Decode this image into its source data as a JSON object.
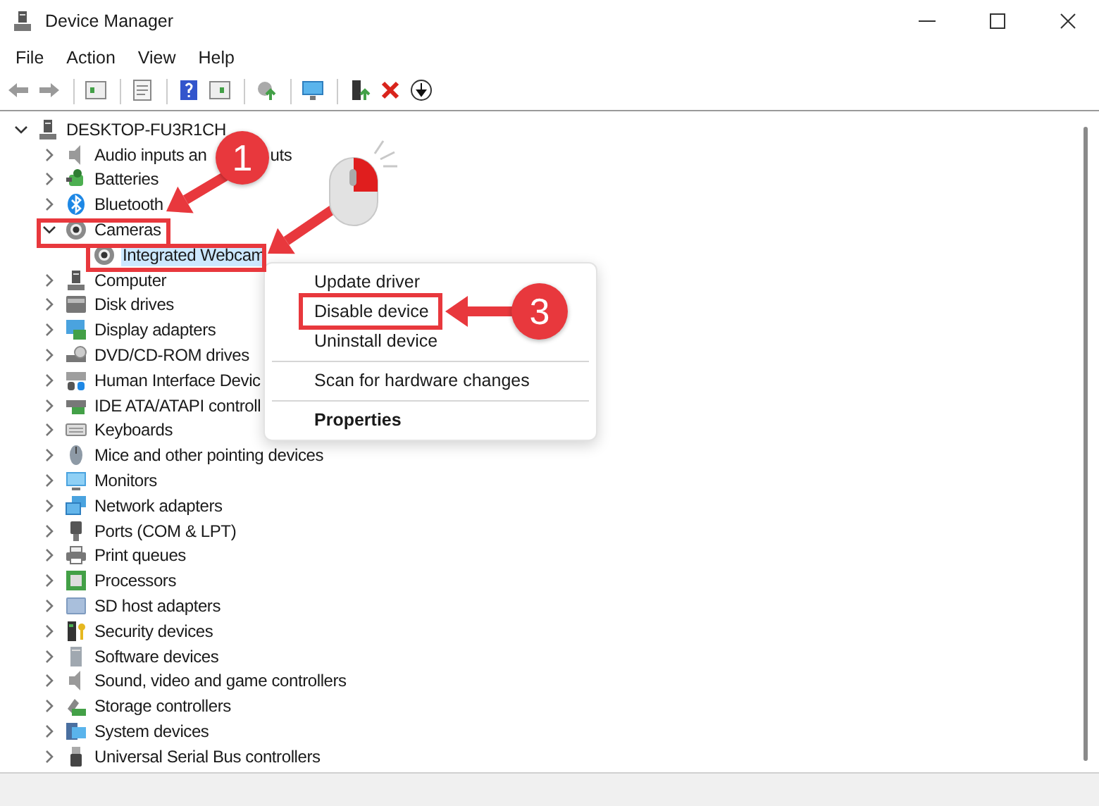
{
  "window": {
    "title": "Device Manager"
  },
  "menu_bar": [
    {
      "label": "File"
    },
    {
      "label": "Action"
    },
    {
      "label": "View"
    },
    {
      "label": "Help"
    }
  ],
  "tree": {
    "label": "DESKTOP-FU3R1CH",
    "expanded": true,
    "selected": false,
    "children": [
      {
        "label": "Audio inputs an",
        "label_tail": "uts",
        "expanded": false,
        "selected": false
      },
      {
        "label": "Batteries",
        "expanded": false,
        "selected": false
      },
      {
        "label": "Bluetooth",
        "expanded": false,
        "selected": false
      },
      {
        "label": "Cameras",
        "expanded": true,
        "selected": false,
        "children": [
          {
            "label": "Integrated Webcam",
            "selected": true
          }
        ]
      },
      {
        "label": "Computer",
        "expanded": false,
        "selected": false
      },
      {
        "label": "Disk drives",
        "expanded": false,
        "selected": false
      },
      {
        "label": "Display adapters",
        "expanded": false,
        "selected": false
      },
      {
        "label": "DVD/CD-ROM drives",
        "expanded": false,
        "selected": false
      },
      {
        "label": "Human Interface Devic",
        "expanded": false,
        "selected": false
      },
      {
        "label": "IDE ATA/ATAPI controll",
        "expanded": false,
        "selected": false
      },
      {
        "label": "Keyboards",
        "expanded": false,
        "selected": false
      },
      {
        "label": "Mice and other pointing devices",
        "expanded": false,
        "selected": false
      },
      {
        "label": "Monitors",
        "expanded": false,
        "selected": false
      },
      {
        "label": "Network adapters",
        "expanded": false,
        "selected": false
      },
      {
        "label": "Ports (COM & LPT)",
        "expanded": false,
        "selected": false
      },
      {
        "label": "Print queues",
        "expanded": false,
        "selected": false
      },
      {
        "label": "Processors",
        "expanded": false,
        "selected": false
      },
      {
        "label": "SD host adapters",
        "expanded": false,
        "selected": false
      },
      {
        "label": "Security devices",
        "expanded": false,
        "selected": false
      },
      {
        "label": "Software devices",
        "expanded": false,
        "selected": false
      },
      {
        "label": "Sound, video and game controllers",
        "expanded": false,
        "selected": false
      },
      {
        "label": "Storage controllers",
        "expanded": false,
        "selected": false
      },
      {
        "label": "System devices",
        "expanded": false,
        "selected": false
      },
      {
        "label": "Universal Serial Bus controllers",
        "expanded": false,
        "selected": false
      }
    ]
  },
  "context_menu": {
    "groups": [
      {
        "items": [
          {
            "label": "Update driver",
            "default": false
          },
          {
            "label": "Disable device",
            "default": false
          },
          {
            "label": "Uninstall device",
            "default": false
          }
        ]
      },
      {
        "items": [
          {
            "label": "Scan for hardware changes",
            "default": false
          }
        ]
      },
      {
        "items": [
          {
            "label": "Properties",
            "default": true
          }
        ]
      }
    ]
  },
  "annotations": [
    {
      "kind": "step",
      "label": "1"
    },
    {
      "kind": "step",
      "label": "3"
    }
  ]
}
